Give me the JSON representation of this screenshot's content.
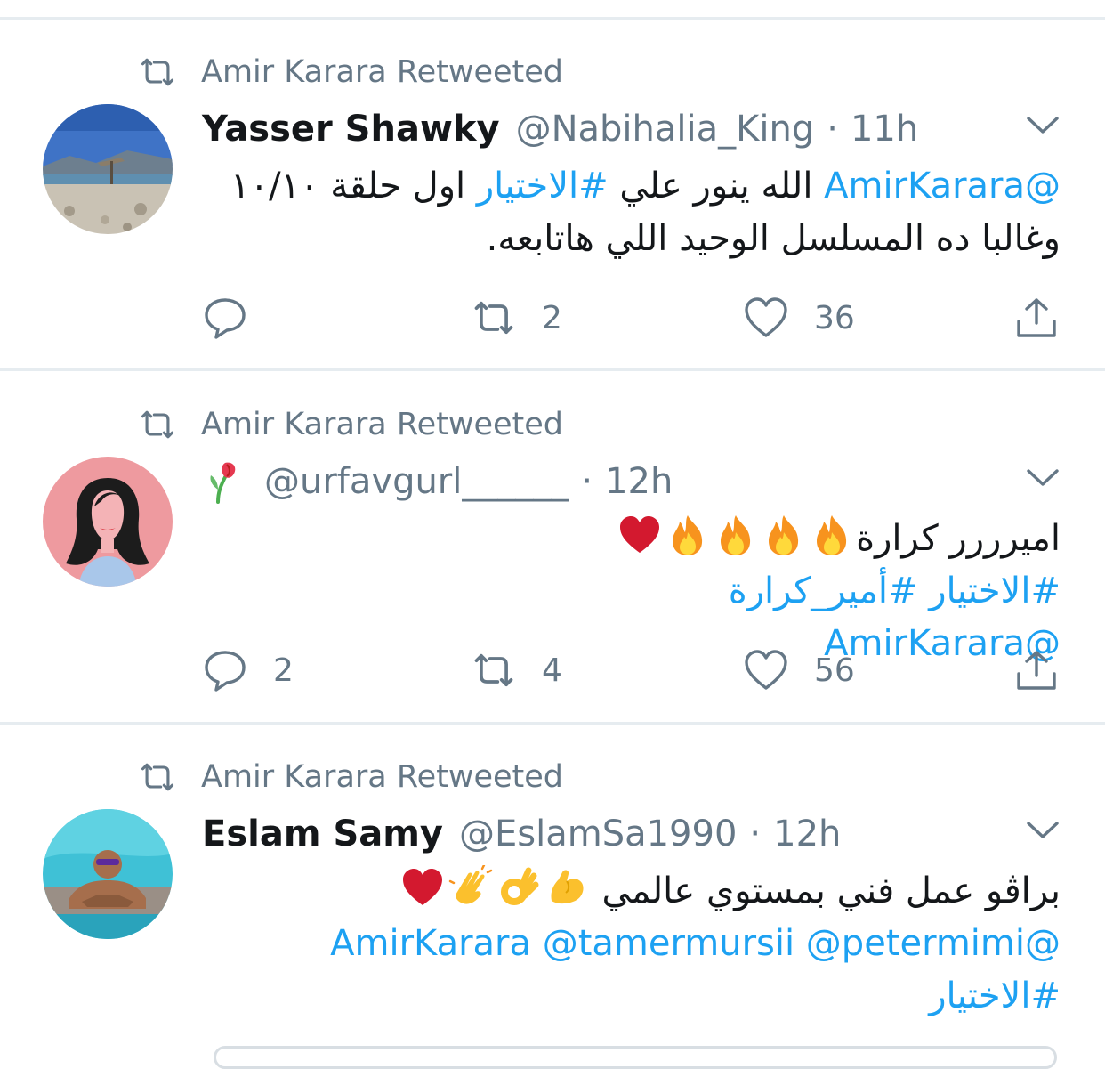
{
  "tweets": [
    {
      "retweeted_by": "Amir Karara Retweeted",
      "name": "Yasser Shawky",
      "handle": "@Nabihalia_King",
      "dot": "·",
      "time": "11h",
      "line1": {
        "mention": "@AmirKarara",
        "text_a": " الله ينور علي ",
        "hashtag": "#الاختيار",
        "text_b": " اول حلقة ١٠/١٠"
      },
      "line2": "وغالبا ده المسلسل الوحيد اللي هاتابعه.",
      "replies": "",
      "retweets": "2",
      "likes": "36"
    },
    {
      "retweeted_by": "Amir Karara Retweeted",
      "name": "",
      "handle": "@urfavgurl______",
      "dot": "·",
      "time": "12h",
      "line1": {
        "text": "اميرررر كرارة"
      },
      "line2": {
        "hashtag1": "#الاختيار",
        "hashtag2": "#أمير_كرارة"
      },
      "line3": "@AmirKarara",
      "replies": "2",
      "retweets": "4",
      "likes": "56"
    },
    {
      "retweeted_by": "Amir Karara Retweeted",
      "name": "Eslam Samy",
      "handle": "@EslamSa1990",
      "dot": "·",
      "time": "12h",
      "line1": {
        "text": "براڤو عمل فني بمستوي عالمي"
      },
      "line2": {
        "m1": "@petermimi",
        "m2": "@tamermursii",
        "m3": "@AmirKarara"
      },
      "line3": "#الاختيار"
    }
  ],
  "icons": {
    "retweet": "retweet-icon",
    "reply": "reply-icon",
    "like": "heart-icon",
    "share": "share-icon",
    "chevron": "chevron-down-icon",
    "emoji_fire": "fire-emoji",
    "emoji_heart": "red-heart-emoji",
    "emoji_flex": "flexed-biceps-emoji",
    "emoji_ok": "ok-hand-emoji",
    "emoji_clap": "clapping-hands-emoji",
    "emoji_rose": "wilted-rose-emoji"
  },
  "colors": {
    "link": "#1da1f2",
    "secondary": "#657786",
    "divider": "#e6ecf0",
    "heart": "#d3192f"
  }
}
